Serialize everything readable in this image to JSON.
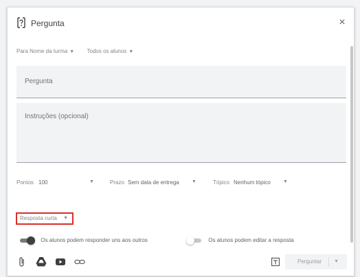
{
  "dialog": {
    "title": "Pergunta",
    "close_label": "×"
  },
  "top_row": {
    "for": "Para Nome da turma",
    "students": "Todos os alunos"
  },
  "question_field": {
    "placeholder": "Pergunta"
  },
  "instructions_field": {
    "placeholder": "Instruções (opcional)"
  },
  "params": {
    "points_label": "Pontos",
    "points_value": "100",
    "due_label": "Prazo",
    "due_value": "Sem data de entrega",
    "topic_label": "Tópico",
    "topic_value": "Nenhum tópico"
  },
  "answer_type": {
    "label": "Resposta curta"
  },
  "toggles": [
    {
      "label": "Os alunos podem responder uns aos outros",
      "on": true
    },
    {
      "label": "Os alunos podem editar a resposta",
      "on": false
    }
  ],
  "actions": {
    "ask_label": "Perguntar"
  },
  "icons": {
    "title": "question-icon",
    "attach": "paperclip-icon",
    "drive": "drive-icon",
    "youtube": "youtube-icon",
    "link": "link-icon",
    "topic": "topic-icon"
  },
  "colors": {
    "highlight": "#d93025",
    "field_bg": "#f1f3f4"
  }
}
